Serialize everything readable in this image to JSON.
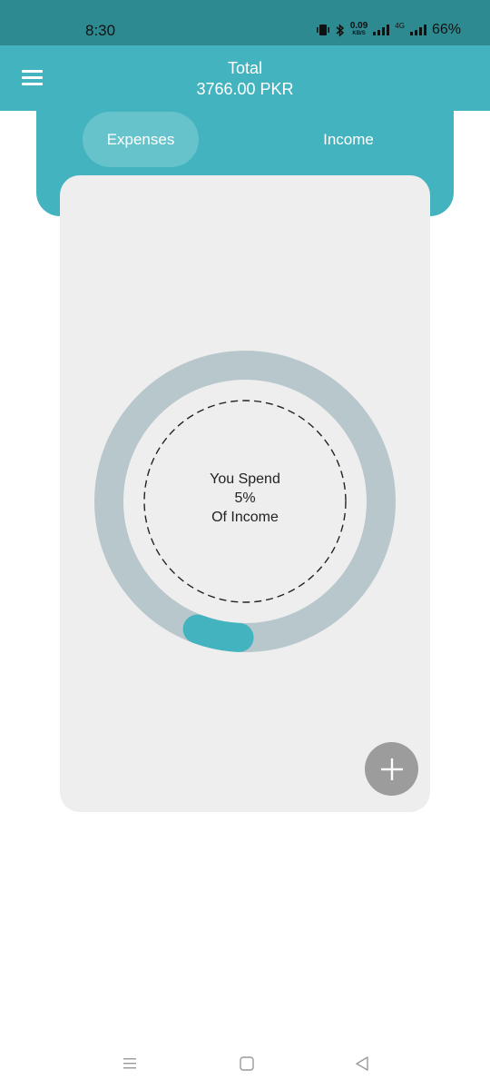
{
  "status_bar": {
    "time": "8:30",
    "net_speed_value": "0.09",
    "net_speed_unit": "KB/S",
    "network_type": "4G",
    "battery": "66%"
  },
  "header": {
    "title": "Total",
    "amount": "3766.00 PKR"
  },
  "tabs": [
    {
      "label": "Expenses",
      "selected": true
    },
    {
      "label": "Income",
      "selected": false
    }
  ],
  "summary": {
    "line1": "You Spend",
    "percent": "5%",
    "line3": "Of Income",
    "spend_fraction": 0.05
  },
  "colors": {
    "accent": "#43b4bf",
    "status_bar": "#2e8a91",
    "ring_track": "#b8c7cc",
    "card_bg": "#eeeeee",
    "fab": "#9c9c9c"
  },
  "icons": {
    "menu": "menu-icon",
    "add": "plus-icon",
    "nav_recents": "recents-icon",
    "nav_home": "home-icon",
    "nav_back": "back-icon"
  }
}
